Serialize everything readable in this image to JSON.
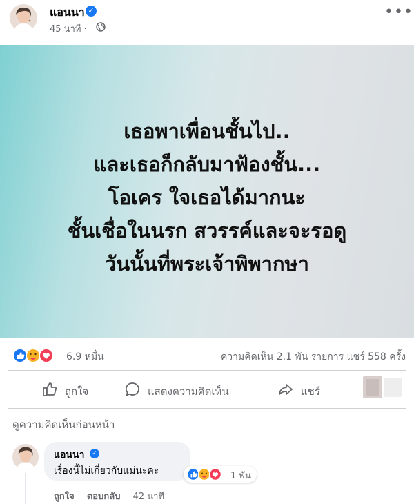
{
  "post": {
    "author": "แอนนา",
    "time": "45 นาที ·",
    "image_lines": [
      "เธอพาเพื่อนชั้นไป..",
      "และเธอก็กลับมาฟ้องชั้น...",
      "โอเคร ใจเธอได้มากนะ",
      "ชั้นเชื่อในนรก สวรรค์และจะรอดู",
      "วันนั้นที่พระเจ้าพิพากษา"
    ]
  },
  "reactions": {
    "count": "6.9 หมื่น",
    "icons": [
      "like-icon",
      "care-icon",
      "love-icon"
    ],
    "stats": "ความคิดเห็น 2.1 พัน รายการ  แชร์ 558 ครั้ง"
  },
  "actions": {
    "like": "ถูกใจ",
    "comment": "แสดงความคิดเห็น",
    "share": "แชร์"
  },
  "comments": {
    "view_previous": "ดูความคิดเห็นก่อนหน้า",
    "items": [
      {
        "author": "แอนนา",
        "text": "เรื่องนี้ไม่เกี่ยวกับแม่นะคะ",
        "reaction_count": "1 พัน",
        "like": "ถูกใจ",
        "reply": "ตอบกลับ",
        "time": "42 นาที"
      }
    ]
  },
  "colors": {
    "brand": "#1877f2",
    "love": "#f33e58",
    "care": "#f7b125",
    "secondary_text": "#65676b"
  }
}
